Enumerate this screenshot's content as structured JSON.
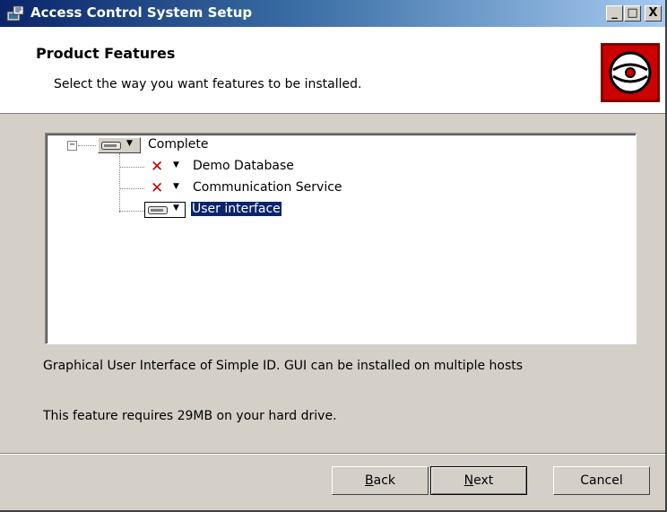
{
  "window": {
    "title": "Access Control System Setup",
    "controls": {
      "minimize": "_",
      "maximize": "□",
      "close": "X"
    }
  },
  "banner": {
    "title": "Product Features",
    "description": "Select the way you want features to be installed.",
    "logo_icon": "cd-disc-icon"
  },
  "tree": {
    "root": {
      "label": "Complete",
      "state": "install-local",
      "expanded": true,
      "expander": "−"
    },
    "children": [
      {
        "label": "Demo Database",
        "state": "not-installed"
      },
      {
        "label": "Communication Service",
        "state": "not-installed"
      },
      {
        "label": "User interface",
        "state": "install-local",
        "selected": true
      }
    ]
  },
  "feature_description": "Graphical User Interface of Simple ID. GUI can be installed on multiple hosts",
  "feature_requirement": "This feature requires 29MB on your hard drive.",
  "buttons": {
    "back": {
      "label_first": "B",
      "label_rest": "ack"
    },
    "next": {
      "label_first": "N",
      "label_rest": "ext"
    },
    "cancel": "Cancel"
  },
  "colors": {
    "accent": "#0a246a",
    "not_installed": "#c00000",
    "logo_bg": "#cc0000"
  }
}
